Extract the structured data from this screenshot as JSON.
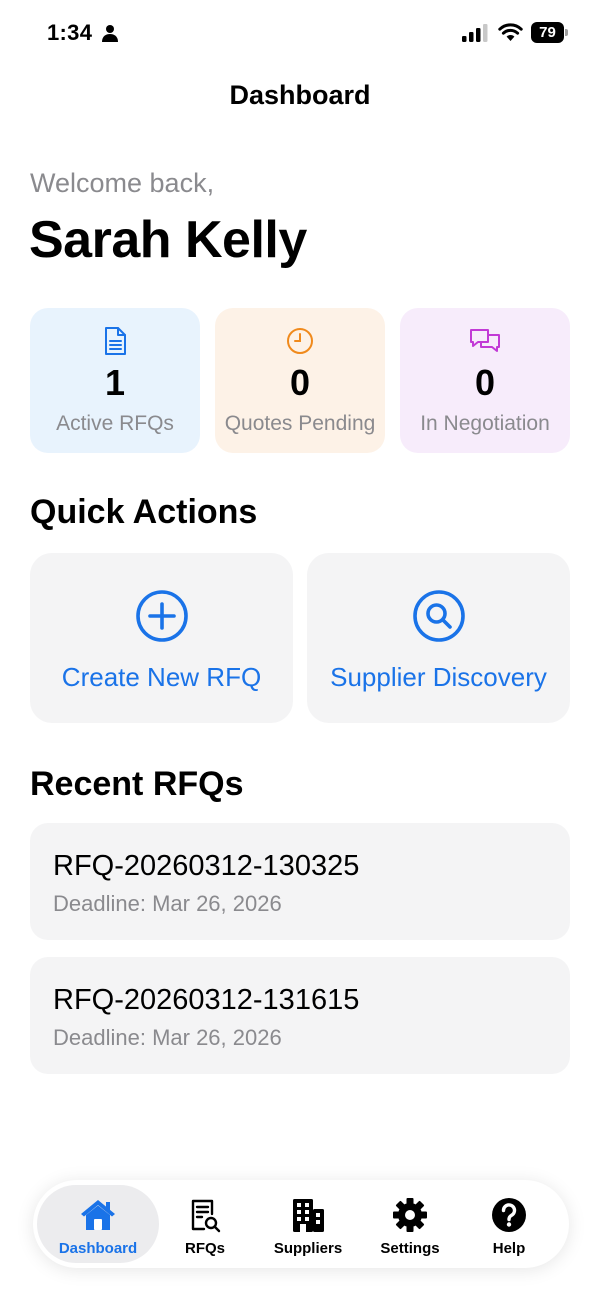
{
  "status_bar": {
    "time": "1:34",
    "battery": "79"
  },
  "header": {
    "title": "Dashboard"
  },
  "greeting": {
    "welcome": "Welcome back,",
    "name": "Sarah Kelly"
  },
  "stats": [
    {
      "icon": "document-icon",
      "value": "1",
      "label": "Active RFQs",
      "color": "#1a73e8"
    },
    {
      "icon": "clock-icon",
      "value": "0",
      "label": "Quotes Pending",
      "color": "#f08a1c"
    },
    {
      "icon": "chat-bubbles-icon",
      "value": "0",
      "label": "In Negotiation",
      "color": "#c23ad6"
    }
  ],
  "quick_actions": {
    "title": "Quick Actions",
    "items": [
      {
        "icon": "plus-circle-icon",
        "label": "Create New RFQ"
      },
      {
        "icon": "magnifier-icon",
        "label": "Supplier Discovery"
      }
    ]
  },
  "recent": {
    "title": "Recent RFQs",
    "items": [
      {
        "id": "RFQ-20260312-130325",
        "deadline": "Deadline: Mar 26, 2026"
      },
      {
        "id": "RFQ-20260312-131615",
        "deadline": "Deadline: Mar 26, 2026"
      }
    ]
  },
  "tabs": [
    {
      "icon": "home-icon",
      "label": "Dashboard",
      "active": true
    },
    {
      "icon": "rfq-document-search-icon",
      "label": "RFQs"
    },
    {
      "icon": "building-icon",
      "label": "Suppliers"
    },
    {
      "icon": "gear-icon",
      "label": "Settings"
    },
    {
      "icon": "help-icon",
      "label": "Help"
    }
  ],
  "colors": {
    "accent": "#1a73e8",
    "secondary_text": "#8a8a8e",
    "card_bg": "#f4f4f5"
  }
}
